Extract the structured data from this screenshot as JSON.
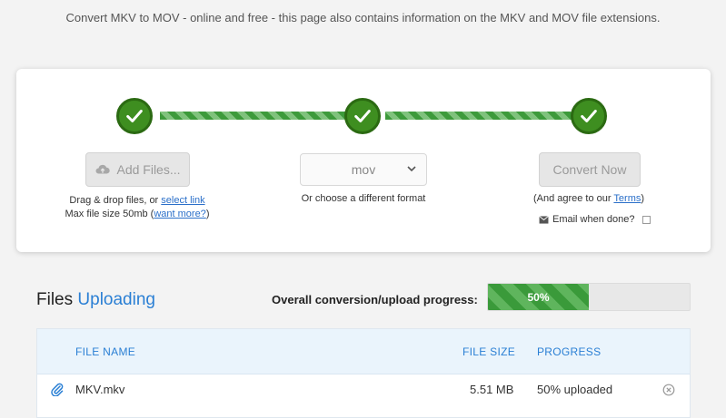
{
  "page": {
    "subtitle": "Convert MKV to MOV - online and free - this page also contains information on the MKV and MOV file extensions."
  },
  "converter": {
    "steps": [
      {
        "icon": "checkmark-icon",
        "done": true
      },
      {
        "icon": "checkmark-icon",
        "done": true
      },
      {
        "icon": "checkmark-icon",
        "done": true
      }
    ],
    "add_files_label": "Add Files...",
    "add_files_icon": "cloud-upload-icon",
    "drag_prefix": "Drag & drop files, or ",
    "select_link": "select link",
    "max_size_prefix": "Max file size 50mb (",
    "want_more_link": "want more?",
    "max_size_suffix": ")",
    "format_value": "mov",
    "format_hint": "Or choose a different format",
    "convert_label": "Convert Now",
    "agree_prefix": "(And agree to our ",
    "terms_link": "Terms",
    "agree_suffix": ")",
    "email_label": "Email when done?",
    "email_icon": "envelope-icon"
  },
  "files": {
    "title_prefix": "Files",
    "title_status": "Uploading",
    "overall_label": "Overall conversion/upload progress:",
    "overall_progress_text": "50%",
    "overall_progress_value": 0.5,
    "columns": {
      "name": "FILE NAME",
      "size": "FILE SIZE",
      "progress": "PROGRESS"
    },
    "rows": [
      {
        "icon": "paperclip-icon",
        "name": "MKV.mkv",
        "size": "5.51 MB",
        "progress": "50% uploaded",
        "remove_icon": "remove-circle-icon"
      }
    ]
  },
  "colors": {
    "accent": "#2a7fd4",
    "success": "#3e8e20",
    "button_disabled": "#e6e6e6"
  }
}
